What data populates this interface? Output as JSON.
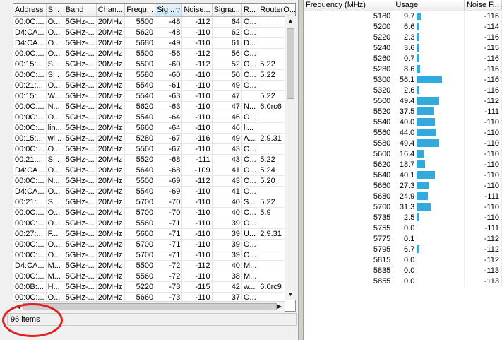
{
  "scan": {
    "columns": [
      "Address",
      "S...",
      "Band",
      "Chan...",
      "Frequ...",
      "Sig...",
      "Noise...",
      "Signa...",
      "R...",
      "RouterO..."
    ],
    "rows": [
      [
        "00:0C:...",
        "O...",
        "5GHz-...",
        "20MHz",
        "5500",
        "-48",
        "-112",
        "64",
        "O...",
        ""
      ],
      [
        "D4:CA...",
        "O...",
        "5GHz-...",
        "20MHz",
        "5620",
        "-48",
        "-110",
        "62",
        "O...",
        ""
      ],
      [
        "D4:CA...",
        "O...",
        "5GHz-...",
        "20MHz",
        "5680",
        "-49",
        "-110",
        "61",
        "D...",
        ""
      ],
      [
        "00:0C:...",
        "O...",
        "5GHz-...",
        "20MHz",
        "5500",
        "-56",
        "-112",
        "56",
        "O...",
        ""
      ],
      [
        "00:15:...",
        "S...",
        "5GHz-...",
        "20MHz",
        "5500",
        "-60",
        "-112",
        "52",
        "O...",
        "5.22"
      ],
      [
        "00:0C:...",
        "S...",
        "5GHz-...",
        "20MHz",
        "5580",
        "-60",
        "-110",
        "50",
        "O...",
        "5.22"
      ],
      [
        "00:21:...",
        "O...",
        "5GHz-...",
        "20MHz",
        "5540",
        "-61",
        "-110",
        "49",
        "O...",
        ""
      ],
      [
        "00:15:...",
        "W...",
        "5GHz-...",
        "20MHz",
        "5540",
        "-63",
        "-110",
        "47",
        "",
        "5.22"
      ],
      [
        "00:0C:...",
        "N...",
        "5GHz-...",
        "20MHz",
        "5620",
        "-63",
        "-110",
        "47",
        "N...",
        "6.0rc6"
      ],
      [
        "00:0C:...",
        "O...",
        "5GHz-...",
        "20MHz",
        "5540",
        "-64",
        "-110",
        "46",
        "O...",
        ""
      ],
      [
        "00:0C:...",
        "lin...",
        "5GHz-...",
        "20MHz",
        "5660",
        "-64",
        "-110",
        "46",
        "li...",
        ""
      ],
      [
        "00:15:...",
        "wi...",
        "5GHz-...",
        "20MHz",
        "5280",
        "-67",
        "-116",
        "49",
        "A...",
        "2.9.31"
      ],
      [
        "00:0C:...",
        "O...",
        "5GHz-...",
        "20MHz",
        "5560",
        "-67",
        "-110",
        "43",
        "O...",
        ""
      ],
      [
        "00:21:...",
        "S...",
        "5GHz-...",
        "20MHz",
        "5520",
        "-68",
        "-111",
        "43",
        "O...",
        "5.22"
      ],
      [
        "D4:CA...",
        "O...",
        "5GHz-...",
        "20MHz",
        "5640",
        "-68",
        "-109",
        "41",
        "O...",
        "5.24"
      ],
      [
        "00:0C:...",
        "N...",
        "5GHz-...",
        "20MHz",
        "5500",
        "-69",
        "-112",
        "43",
        "O...",
        "5.20"
      ],
      [
        "D4:CA...",
        "O...",
        "5GHz-...",
        "20MHz",
        "5540",
        "-69",
        "-110",
        "41",
        "O...",
        ""
      ],
      [
        "00:21:...",
        "S...",
        "5GHz-...",
        "20MHz",
        "5700",
        "-70",
        "-110",
        "40",
        "S...",
        "5.22"
      ],
      [
        "00:0C:...",
        "O...",
        "5GHz-...",
        "20MHz",
        "5700",
        "-70",
        "-110",
        "40",
        "O...",
        "5.9"
      ],
      [
        "00:0C:...",
        "O...",
        "5GHz-...",
        "20MHz",
        "5560",
        "-71",
        "-110",
        "39",
        "O...",
        ""
      ],
      [
        "00:27:...",
        "F...",
        "5GHz-...",
        "20MHz",
        "5660",
        "-71",
        "-110",
        "39",
        "U...",
        "2.9.31"
      ],
      [
        "00:0C:...",
        "O...",
        "5GHz-...",
        "20MHz",
        "5700",
        "-71",
        "-110",
        "39",
        "O...",
        ""
      ],
      [
        "00:0C:...",
        "O...",
        "5GHz-...",
        "20MHz",
        "5700",
        "-71",
        "-110",
        "39",
        "O...",
        ""
      ],
      [
        "D4:CA...",
        "M...",
        "5GHz-...",
        "20MHz",
        "5500",
        "-72",
        "-112",
        "40",
        "M...",
        ""
      ],
      [
        "00:0C:...",
        "M...",
        "5GHz-...",
        "20MHz",
        "5560",
        "-72",
        "-110",
        "38",
        "M...",
        ""
      ],
      [
        "00:0B:...",
        "H...",
        "5GHz-...",
        "20MHz",
        "5220",
        "-73",
        "-115",
        "42",
        "w...",
        "6.0rc9"
      ],
      [
        "00:0C:...",
        "O...",
        "5GHz-...",
        "20MHz",
        "5660",
        "-73",
        "-110",
        "37",
        "O...",
        ""
      ]
    ],
    "status": "96 items"
  },
  "usage": {
    "columns": [
      "Frequency (MHz)",
      "Usage",
      "Noise F..."
    ],
    "bar_color": "#33aadd",
    "rows": [
      {
        "freq": "5180",
        "usage": "9.7",
        "usage_pct": 9.7,
        "noise": "-116"
      },
      {
        "freq": "5200",
        "usage": "6.6",
        "usage_pct": 6.6,
        "noise": "-114"
      },
      {
        "freq": "5220",
        "usage": "2.3",
        "usage_pct": 2.3,
        "noise": "-116"
      },
      {
        "freq": "5240",
        "usage": "3.6",
        "usage_pct": 3.6,
        "noise": "-115"
      },
      {
        "freq": "5260",
        "usage": "0.7",
        "usage_pct": 0.7,
        "noise": "-116"
      },
      {
        "freq": "5280",
        "usage": "8.6",
        "usage_pct": 8.6,
        "noise": "-116"
      },
      {
        "freq": "5300",
        "usage": "56.1",
        "usage_pct": 56.1,
        "noise": "-116"
      },
      {
        "freq": "5320",
        "usage": "2.6",
        "usage_pct": 2.6,
        "noise": "-116"
      },
      {
        "freq": "5500",
        "usage": "49.4",
        "usage_pct": 49.4,
        "noise": "-112"
      },
      {
        "freq": "5520",
        "usage": "37.5",
        "usage_pct": 37.5,
        "noise": "-111"
      },
      {
        "freq": "5540",
        "usage": "40.0",
        "usage_pct": 40.0,
        "noise": "-110"
      },
      {
        "freq": "5560",
        "usage": "44.0",
        "usage_pct": 44.0,
        "noise": "-110"
      },
      {
        "freq": "5580",
        "usage": "49.4",
        "usage_pct": 49.4,
        "noise": "-110"
      },
      {
        "freq": "5600",
        "usage": "16.4",
        "usage_pct": 16.4,
        "noise": "-110"
      },
      {
        "freq": "5620",
        "usage": "18.7",
        "usage_pct": 18.7,
        "noise": "-110"
      },
      {
        "freq": "5640",
        "usage": "40.1",
        "usage_pct": 40.1,
        "noise": "-110"
      },
      {
        "freq": "5660",
        "usage": "27.3",
        "usage_pct": 27.3,
        "noise": "-110"
      },
      {
        "freq": "5680",
        "usage": "24.9",
        "usage_pct": 24.9,
        "noise": "-111"
      },
      {
        "freq": "5700",
        "usage": "31.3",
        "usage_pct": 31.3,
        "noise": "-110"
      },
      {
        "freq": "5735",
        "usage": "2.5",
        "usage_pct": 2.5,
        "noise": "-110"
      },
      {
        "freq": "5755",
        "usage": "0.0",
        "usage_pct": 0.0,
        "noise": "-111"
      },
      {
        "freq": "5775",
        "usage": "0.1",
        "usage_pct": 0.1,
        "noise": "-112"
      },
      {
        "freq": "5795",
        "usage": "6.7",
        "usage_pct": 6.7,
        "noise": "-112"
      },
      {
        "freq": "5815",
        "usage": "0.0",
        "usage_pct": 0.0,
        "noise": "-112"
      },
      {
        "freq": "5835",
        "usage": "0.0",
        "usage_pct": 0.0,
        "noise": "-113"
      },
      {
        "freq": "5855",
        "usage": "0.0",
        "usage_pct": 0.0,
        "noise": "-113"
      }
    ]
  },
  "icons": {
    "sort_indicator": "sort-descending-icon",
    "scroll_up": "scroll-up-arrow-icon",
    "scroll_down": "scroll-down-arrow-icon",
    "scroll_left": "scroll-left-arrow-icon",
    "scroll_right": "scroll-right-arrow-icon"
  },
  "annotation": {
    "color": "#e02020"
  }
}
